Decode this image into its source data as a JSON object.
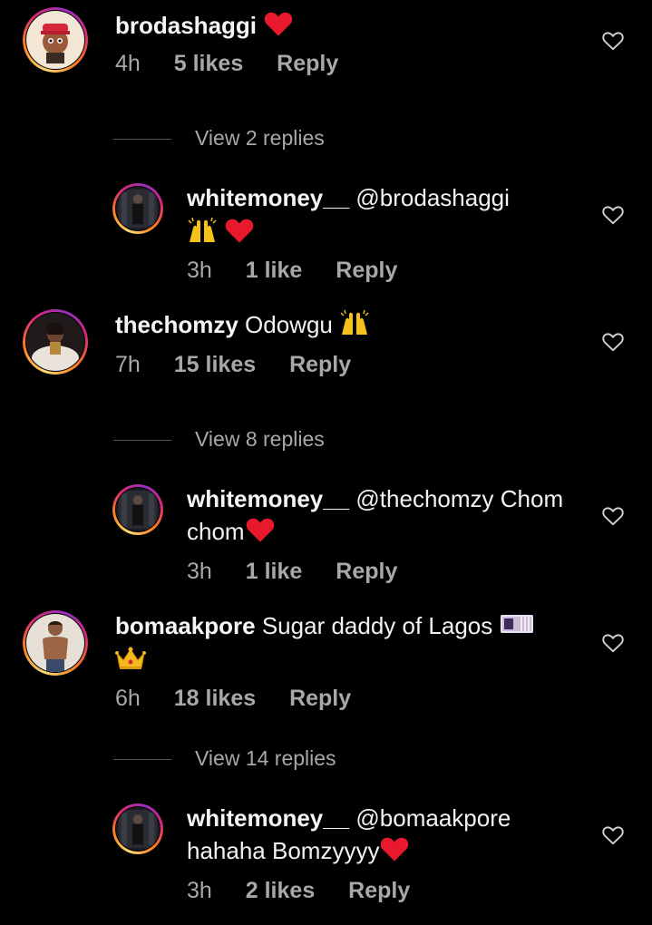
{
  "comments": [
    {
      "username": "brodashaggi",
      "text": "",
      "emoji": "red-heart",
      "time": "4h",
      "likes": "5 likes",
      "reply": "Reply",
      "view_replies": "View 2 replies"
    },
    {
      "username": "whitemoney__",
      "text": "@brodashaggi",
      "emoji_line": [
        "raised-hands",
        "red-heart"
      ],
      "time": "3h",
      "likes": "1 like",
      "reply": "Reply"
    },
    {
      "username": "thechomzy",
      "text": "Odowgu",
      "emoji": "raised-hands",
      "time": "7h",
      "likes": "15 likes",
      "reply": "Reply",
      "view_replies": "View 8 replies"
    },
    {
      "username": "whitemoney__",
      "text_line1": "@thechomzy Chom",
      "text_line2": "chom",
      "emoji": "red-heart",
      "time": "3h",
      "likes": "1 like",
      "reply": "Reply"
    },
    {
      "username": "bomaakpore",
      "text": "Sugar daddy of Lagos",
      "emoji": "money-with-wings",
      "emoji_line": [
        "crown"
      ],
      "time": "6h",
      "likes": "18 likes",
      "reply": "Reply",
      "view_replies": "View 14 replies"
    },
    {
      "username": "whitemoney__",
      "text_line1": "@bomaakpore",
      "text_line2": "hahaha Bomzyyyy",
      "emoji": "red-heart",
      "time": "3h",
      "likes": "2 likes",
      "reply": "Reply"
    }
  ],
  "colors": {
    "background": "#000000",
    "text": "#f5f5f5",
    "meta": "#a8a8a8",
    "heart_red": "#e8192c"
  },
  "icons": {
    "like_button": "heart-outline-icon"
  }
}
